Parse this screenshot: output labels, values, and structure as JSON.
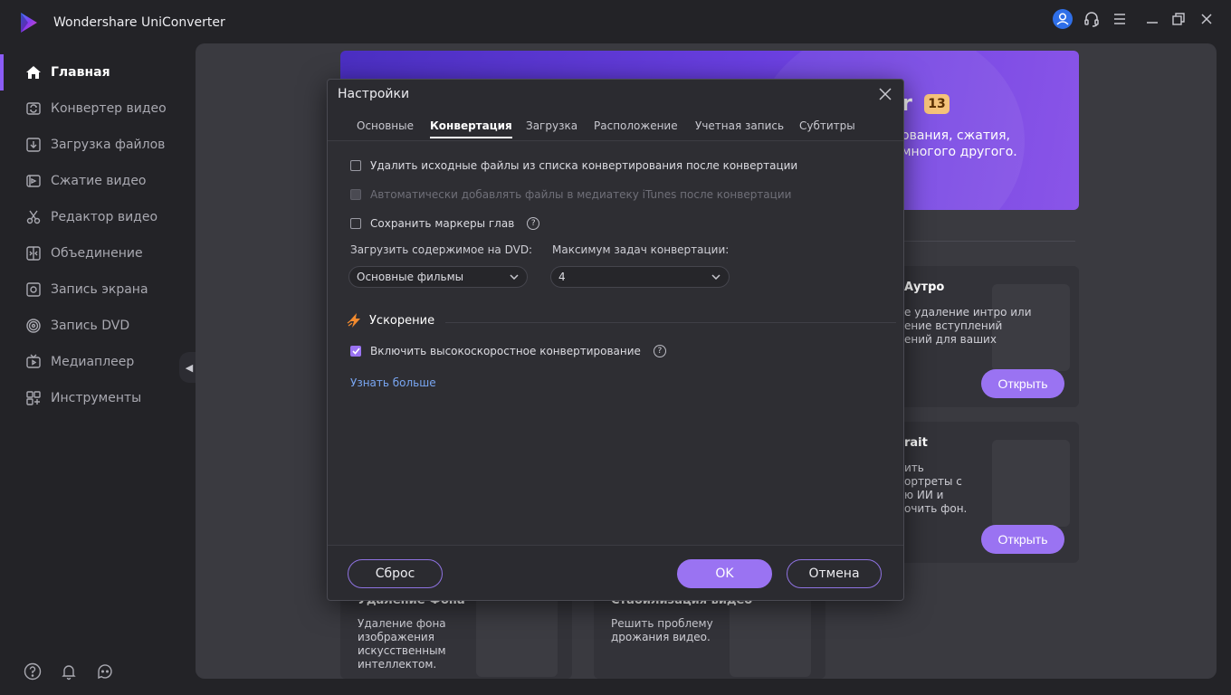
{
  "app": {
    "title": "Wondershare UniConverter"
  },
  "sidebar": {
    "items": [
      {
        "label": "Главная",
        "icon": "home-icon",
        "active": true
      },
      {
        "label": "Конвертер видео",
        "icon": "convert-icon"
      },
      {
        "label": "Загрузка файлов",
        "icon": "download-icon"
      },
      {
        "label": "Сжатие видео",
        "icon": "compress-icon"
      },
      {
        "label": "Редактор видео",
        "icon": "scissors-icon"
      },
      {
        "label": "Объединение",
        "icon": "merge-icon"
      },
      {
        "label": "Запись экрана",
        "icon": "screen-record-icon"
      },
      {
        "label": "Запись DVD",
        "icon": "dvd-icon"
      },
      {
        "label": "Медиаплеер",
        "icon": "media-player-icon"
      },
      {
        "label": "Инструменты",
        "icon": "tools-icon"
      }
    ]
  },
  "banner": {
    "title_fragment": "r",
    "badge": "13",
    "line1": "ования, сжатия,",
    "line2": "многого другого."
  },
  "cards": [
    {
      "title": "Аутро",
      "desc": [
        "е удаление интро или",
        "ение вступлений",
        "ений для ваших"
      ],
      "button": "Открыть"
    },
    {
      "title": "rait",
      "desc": [
        "ить",
        "ортреты с",
        "ю ИИ и",
        "очить фон."
      ],
      "button": "Открыть"
    },
    {
      "title": "Удаление Фона",
      "desc": [
        "Удаление фона",
        "изображения",
        "искусственным",
        "интеллектом."
      ]
    },
    {
      "title": "Стабилизация видео",
      "desc": [
        "Решить проблему",
        "дрожания видео."
      ]
    }
  ],
  "modal": {
    "title": "Настройки",
    "tabs": [
      "Основные",
      "Конвертация",
      "Загрузка",
      "Расположение",
      "Учетная запись",
      "Субтитры"
    ],
    "active_tab": "Конвертация",
    "options": {
      "delete_source": "Удалить исходные файлы из списка конвертирования после конвертации",
      "itunes": "Автоматически добавлять файлы в медиатеку iTunes после конвертации",
      "chapter_markers": "Сохранить маркеры глав"
    },
    "dvd_label": "Загрузить содержимое на DVD:",
    "dvd_value": "Основные фильмы",
    "max_tasks_label": "Максимум задач конвертации:",
    "max_tasks_value": "4",
    "accel_title": "Ускорение",
    "accel_option": "Включить высокоскоростное конвертирование",
    "learn_more": "Узнать больше",
    "buttons": {
      "reset": "Сброс",
      "ok": "OK",
      "cancel": "Отмена"
    }
  },
  "colors": {
    "accent": "#9a73f2",
    "sidebar_active": "#8b5cf6",
    "link": "#79a6f2"
  }
}
